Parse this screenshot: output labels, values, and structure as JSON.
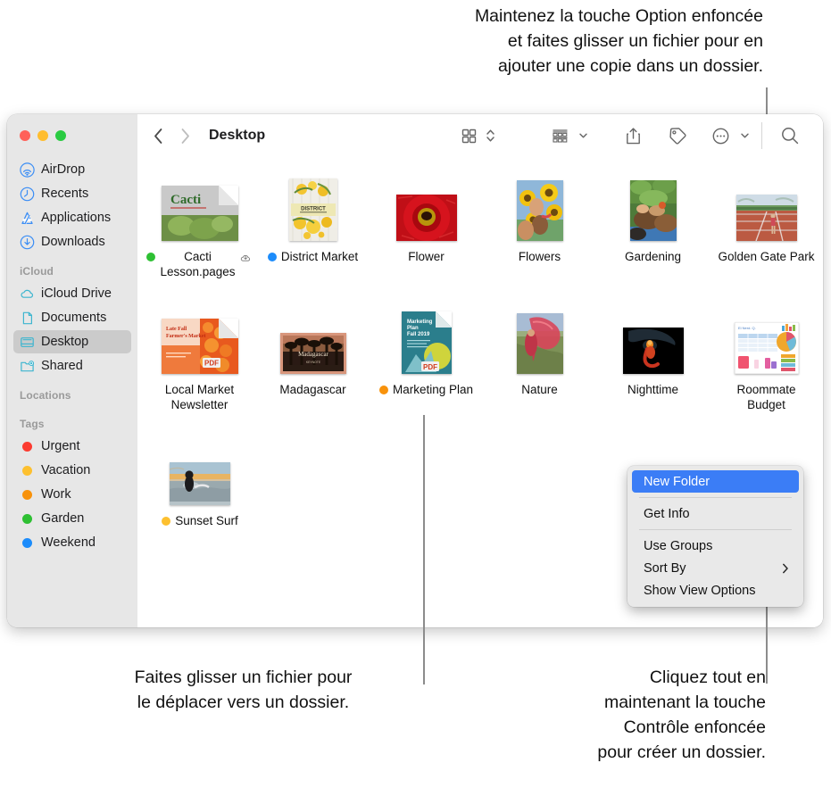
{
  "callouts": {
    "top_right": "Maintenez la touche Option enfoncée\net faites glisser un fichier pour en\najouter une copie dans un dossier.",
    "bottom_left": "Faites glisser un fichier pour\nle déplacer vers un dossier.",
    "bottom_right": "Cliquez tout en\nmaintenant la touche\nContrôle enfoncée\npour créer un dossier."
  },
  "window": {
    "traffic_lights": [
      "close",
      "minimize",
      "zoom"
    ],
    "colors": {
      "close": "#ff6159",
      "minimize": "#ffbd2e",
      "zoom": "#2acb42"
    }
  },
  "toolbar": {
    "back_label": "Back",
    "forward_label": "Forward",
    "title": "Desktop",
    "icon_view_label": "icon-view",
    "group_label": "group-by",
    "share_label": "share",
    "tags_label": "tags",
    "more_label": "more-actions",
    "search_label": "search"
  },
  "sidebar": {
    "favorites": [
      {
        "label": "AirDrop",
        "icon": "airdrop-icon"
      },
      {
        "label": "Recents",
        "icon": "clock-icon"
      },
      {
        "label": "Applications",
        "icon": "applications-icon"
      },
      {
        "label": "Downloads",
        "icon": "downloads-icon"
      }
    ],
    "icloud_header": "iCloud",
    "icloud": [
      {
        "label": "iCloud Drive",
        "icon": "cloud-icon",
        "selected": false
      },
      {
        "label": "Documents",
        "icon": "document-icon",
        "selected": false
      },
      {
        "label": "Desktop",
        "icon": "desktop-icon",
        "selected": true
      },
      {
        "label": "Shared",
        "icon": "shared-folder-icon",
        "selected": false
      }
    ],
    "locations_header": "Locations",
    "tags_header": "Tags",
    "tags": [
      {
        "label": "Urgent",
        "color": "#fc3b30"
      },
      {
        "label": "Vacation",
        "color": "#fdc02f"
      },
      {
        "label": "Work",
        "color": "#f8920b"
      },
      {
        "label": "Garden",
        "color": "#2ec033"
      },
      {
        "label": "Weekend",
        "color": "#1c8cfb"
      }
    ]
  },
  "files": {
    "rows": [
      [
        {
          "name": "Cacti\nLesson.pages",
          "tag": "#2ec033",
          "cloud": true,
          "kind": "pages-doc"
        },
        {
          "name": "District Market",
          "tag": "#1c8cfb",
          "cloud": false,
          "kind": "poster"
        },
        {
          "name": "Flower",
          "tag": null,
          "cloud": false,
          "kind": "photo-flower"
        },
        {
          "name": "Flowers",
          "tag": null,
          "cloud": false,
          "kind": "photo-sunflowers"
        },
        {
          "name": "Gardening",
          "tag": null,
          "cloud": false,
          "kind": "photo-gardening"
        },
        {
          "name": "Golden Gate Park",
          "tag": null,
          "cloud": false,
          "kind": "photo-track"
        }
      ],
      [
        {
          "name": "Local Market\nNewsletter",
          "tag": null,
          "cloud": false,
          "kind": "pdf-newsletter"
        },
        {
          "name": "Madagascar",
          "tag": null,
          "cloud": false,
          "kind": "photo-madagascar"
        },
        {
          "name": "Marketing Plan",
          "tag": "#f8920b",
          "cloud": false,
          "kind": "pdf-marketing"
        },
        {
          "name": "Nature",
          "tag": null,
          "cloud": false,
          "kind": "photo-nature"
        },
        {
          "name": "Nighttime",
          "tag": null,
          "cloud": false,
          "kind": "photo-night"
        },
        {
          "name": "Roommate\nBudget",
          "tag": null,
          "cloud": false,
          "kind": "numbers-doc"
        }
      ],
      [
        {
          "name": "Sunset Surf",
          "tag": "#fdc02f",
          "cloud": false,
          "kind": "photo-surf"
        }
      ]
    ]
  },
  "context_menu": {
    "items": [
      {
        "label": "New Folder",
        "highlighted": true,
        "submenu": false,
        "separator_after": true
      },
      {
        "label": "Get Info",
        "highlighted": false,
        "submenu": false,
        "separator_after": true
      },
      {
        "label": "Use Groups",
        "highlighted": false,
        "submenu": false,
        "separator_after": false
      },
      {
        "label": "Sort By",
        "highlighted": false,
        "submenu": true,
        "separator_after": false
      },
      {
        "label": "Show View Options",
        "highlighted": false,
        "submenu": false,
        "separator_after": false
      }
    ],
    "highlight_color": "#3b7df6"
  }
}
